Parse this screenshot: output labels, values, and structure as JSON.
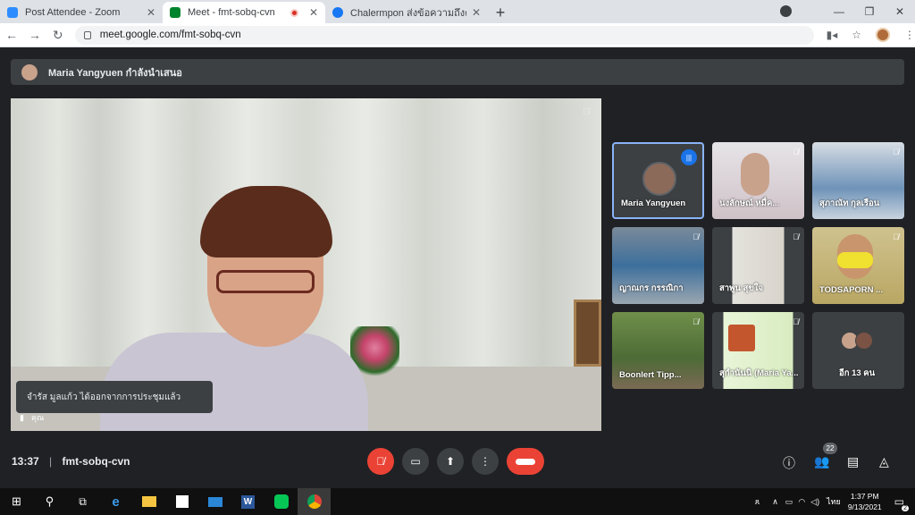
{
  "browser": {
    "tabs": [
      {
        "title": "Post Attendee - Zoom",
        "color": "#2d8cff"
      },
      {
        "title": "Meet - fmt-sobq-cvn",
        "color": "#00832d",
        "active": true,
        "recording": true
      },
      {
        "title": "Chalermpon ส่งข้อความถึงคุณ",
        "color": "#1877f2"
      }
    ],
    "url": "meet.google.com/fmt-sobq-cvn"
  },
  "meet": {
    "presenting_banner": "Maria Yangyuen กำลังนำเสนอ",
    "toast": "จำรัส มูลแก้ว ได้ออกจากการประชุมแล้ว",
    "self_label": "คุณ",
    "time": "13:37",
    "meeting_code": "fmt-sobq-cvn",
    "participant_count": "22",
    "tiles": [
      {
        "name": "Maria Yangyuen"
      },
      {
        "name": "นงลักษณ์ หมื่ค..."
      },
      {
        "name": "สุภาณัท กุลเรือน"
      },
      {
        "name": "ญาณกร กรรณิกา"
      },
      {
        "name": "สาพูน สุขใจ"
      },
      {
        "name": "TODSAPORN ..."
      },
      {
        "name": "Boonlert Tipp..."
      },
      {
        "name": "สุกำนันนิ (Maria Ya..."
      },
      {
        "name": "อีก 13 คน"
      }
    ]
  },
  "taskbar": {
    "time": "1:37 PM",
    "date": "9/13/2021",
    "lang": "ไทย",
    "notif_count": "2"
  }
}
